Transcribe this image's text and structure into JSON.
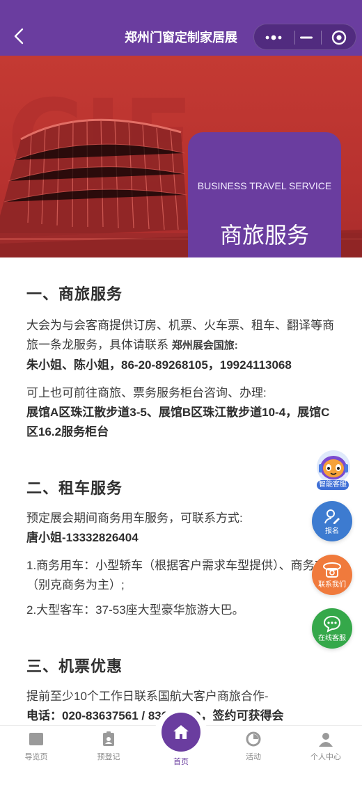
{
  "header": {
    "title": "郑州门窗定制家居展"
  },
  "banner": {
    "card_en": "BUSINESS TRAVEL SERVICE",
    "card_zh": "商旅服务"
  },
  "sections": [
    {
      "title": "一、商旅服务",
      "para1": "大会为与会客商提供订房、机票、火车票、租车、翻译等商旅一条龙服务，具体请联系",
      "para1_tail": "郑州展会国旅:",
      "contacts": "朱小姐、陈小姐，86-20-89268105，19924113068",
      "para2": "可上也可前往商旅、票务服务柜台咨询、办理:",
      "venues": "展馆A区珠江散步道3-5、展馆B区珠江散步道10-4，展馆C区16.2服务柜台"
    },
    {
      "title": "二、租车服务",
      "para1": "预定展会期间商务用车服务，可联系方式:",
      "contact": "唐小姐-13332826404",
      "item1": "1.商务用车：小型轿车（根据客户需求车型提供）、商务车（别克商务为主）;",
      "item2": "2.大型客车：37-53座大型豪华旅游大巴。"
    },
    {
      "title": "三、机票优惠",
      "para1": "提前至少10个工作日联系国航大客户商旅合作-",
      "phone": "电话：020-83637561 / 83637570，签约可获得会"
    }
  ],
  "float_buttons": {
    "robot": "智能客服",
    "register": "报名",
    "contact": "联系我们",
    "online": "在线客服"
  },
  "nav": {
    "items": [
      {
        "label": "导览页"
      },
      {
        "label": "预登记"
      },
      {
        "label": "首页"
      },
      {
        "label": "活动"
      },
      {
        "label": "个人中心"
      }
    ]
  },
  "colors": {
    "brand": "#6a3d9f",
    "banner_red": "#c43a33",
    "register_blue": "#3d7bd0",
    "contact_orange": "#f07a3c",
    "online_green": "#35a84a"
  }
}
